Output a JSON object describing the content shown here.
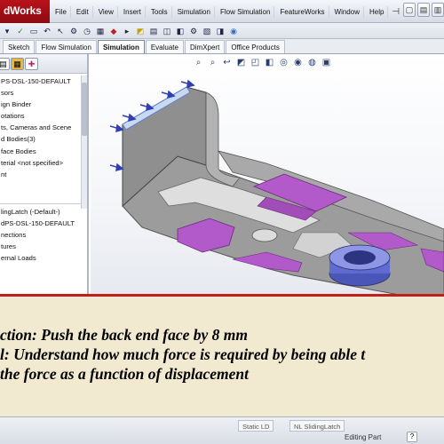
{
  "app": {
    "logo_text": "dWorks",
    "menu": [
      "File",
      "Edit",
      "View",
      "Insert",
      "Tools",
      "Simulation",
      "Flow Simulation",
      "FeatureWorks",
      "Window",
      "Help"
    ],
    "pin": "⊣"
  },
  "tabs": [
    "Sketch",
    "Flow Simulation",
    "Simulation",
    "Evaluate",
    "DimXpert",
    "Office Products"
  ],
  "active_tab": "Simulation",
  "tree": {
    "items_top": [
      "PS-DSL-150-DEFAULT",
      "sors",
      "ign Binder",
      "otations",
      "ts, Cameras and Scene",
      "d Bodies(3)",
      "face Bodies",
      "terial <not specified>",
      "nt",
      ""
    ],
    "items_bottom": [
      "lingLatch (-Default-)",
      "dPS-DSL-150-DEFAULT",
      "nections",
      "tures",
      "ernal Loads"
    ]
  },
  "slide": {
    "line1": "ction: Push the back end face by 8 mm",
    "line2": "l: Understand how much force is required by being able t",
    "line3": "the force as a function of displacement"
  },
  "statusbar": {
    "tab1": "Static LD",
    "tab2": "NL SlidingLatch",
    "status": "Editing Part",
    "help": "?"
  },
  "colors": {
    "accent_red": "#c41d1d",
    "part_gray": "#9a9a9a",
    "part_purple": "#b25ac9",
    "fixture_blue": "#6f7fd6"
  }
}
